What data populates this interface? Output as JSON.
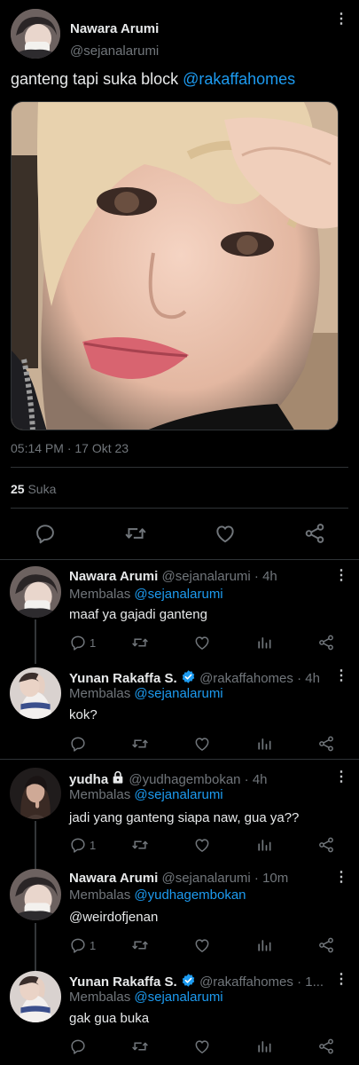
{
  "main_tweet": {
    "author_name": "Nawara Arumi",
    "author_handle": "@sejanalarumi",
    "text_prefix": "ganteng tapi suka block ",
    "text_mention": "@rakaffahomes",
    "timestamp": "05:14 PM · 17 Okt 23",
    "like_count": "25",
    "like_label": "Suka"
  },
  "replies": [
    {
      "name": "Nawara Arumi",
      "handle_time": "@sejanalarumi · 4h",
      "replying_label": "Membalas",
      "replying_to": "@sejanalarumi",
      "text": "maaf ya gajadi ganteng",
      "reply_count": "1"
    },
    {
      "name": "Yunan Rakaffa S.",
      "handle_time": "@rakaffahomes · 4h",
      "replying_label": "Membalas",
      "replying_to": "@sejanalarumi",
      "text": "kok?",
      "reply_count": ""
    },
    {
      "name": "yudha",
      "handle_time": "@yudhagembokan · 4h",
      "replying_label": "Membalas",
      "replying_to": "@sejanalarumi",
      "text": "jadi yang ganteng siapa naw, gua ya??",
      "reply_count": "1"
    },
    {
      "name": "Nawara Arumi",
      "handle_time": "@sejanalarumi · 10m",
      "replying_label": "Membalas",
      "replying_to": "@yudhagembokan",
      "text": "@weirdofjenan",
      "reply_count": "1"
    },
    {
      "name": "Yunan Rakaffa S.",
      "handle_time": "@rakaffahomes · 1...",
      "replying_label": "Membalas",
      "replying_to": "@sejanalarumi",
      "text": "gak gua buka",
      "reply_count": ""
    }
  ],
  "icons": {
    "more": "more-dots-icon",
    "reply": "reply-icon",
    "retweet": "retweet-icon",
    "like": "like-icon",
    "views": "views-icon",
    "share": "share-icon",
    "verified": "verified-badge-icon",
    "lock": "lock-icon"
  },
  "colors": {
    "background": "#000000",
    "text": "#e7e9ea",
    "muted": "#71767b",
    "link": "#1d9bf0",
    "divider": "#2f3336"
  }
}
